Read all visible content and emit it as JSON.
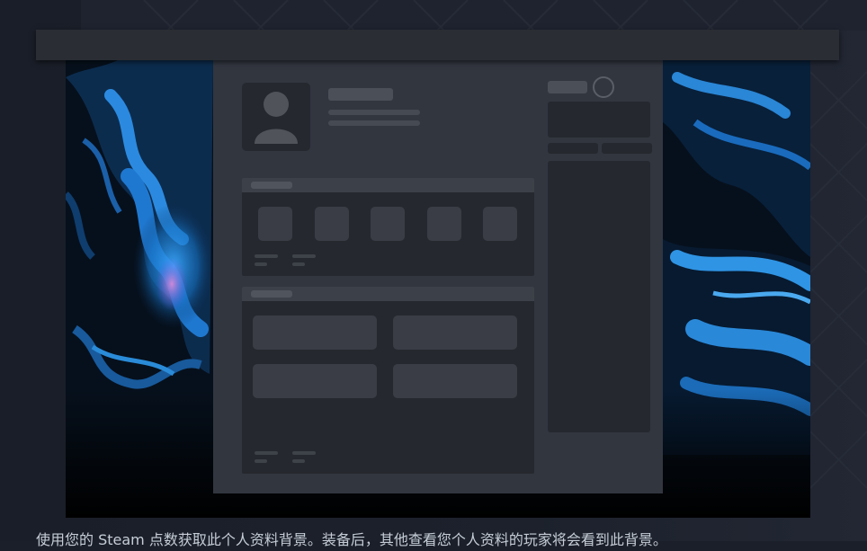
{
  "preview": {
    "title": "",
    "description": "使用您的 Steam 点数获取此个人资料背景。装备后，其他查看您个人资料的玩家将会看到此背景。"
  },
  "colors": {
    "page_background": "#1b1f29",
    "title_bar": "#2a2d33",
    "profile_panel": "#32363f",
    "placeholder_dark": "#25282e",
    "placeholder_tile": "#3a3d45",
    "wallpaper_accent": "#1d8bd8",
    "description_text": "#c6cdd6"
  },
  "icons": {
    "avatar": "person-silhouette-icon"
  }
}
